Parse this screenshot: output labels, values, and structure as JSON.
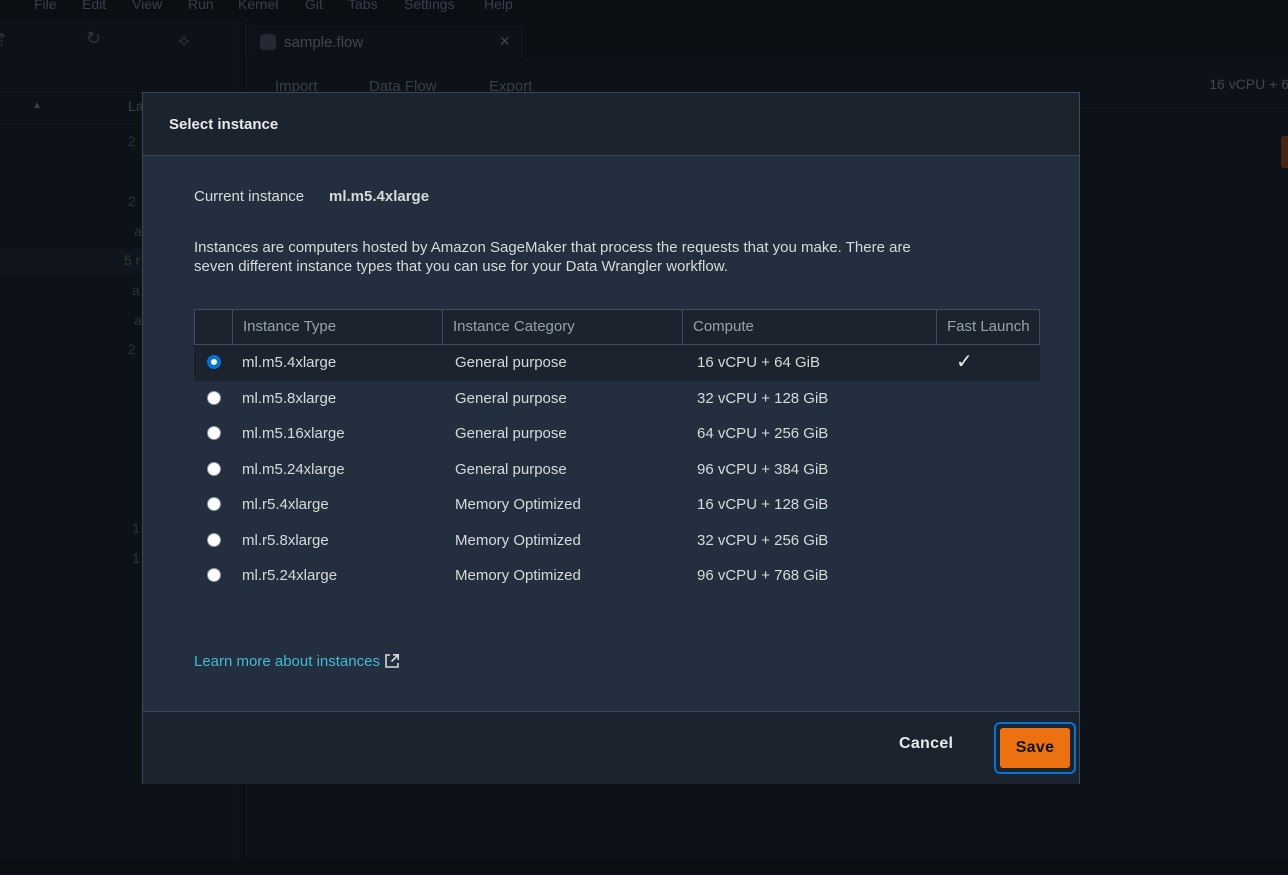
{
  "menu": [
    "File",
    "Edit",
    "View",
    "Run",
    "Kernel",
    "Git",
    "Tabs",
    "Settings",
    "Help"
  ],
  "file_tab": {
    "label": "sample.flow"
  },
  "subtabs": [
    "Import",
    "Data Flow",
    "Export"
  ],
  "top_right_label": "16 vCPU + 6",
  "left_panel": {
    "header": "La",
    "rows": [
      "2",
      "2",
      "a",
      "5 r",
      "a",
      "a",
      "2",
      "1",
      "1"
    ]
  },
  "modal": {
    "title": "Select instance",
    "current_label": "Current instance",
    "current_value": "ml.m5.4xlarge",
    "description": "Instances are computers hosted by Amazon SageMaker that process the requests that you make. There are seven different instance types that you can use for your Data Wrangler workflow.",
    "columns": [
      "Instance Type",
      "Instance Category",
      "Compute",
      "Fast Launch"
    ],
    "rows": [
      {
        "type": "ml.m5.4xlarge",
        "category": "General purpose",
        "compute": "16 vCPU + 64 GiB",
        "fast_launch": "✓",
        "selected": true
      },
      {
        "type": "ml.m5.8xlarge",
        "category": "General purpose",
        "compute": "32 vCPU + 128 GiB",
        "fast_launch": "",
        "selected": false
      },
      {
        "type": "ml.m5.16xlarge",
        "category": "General purpose",
        "compute": "64 vCPU + 256 GiB",
        "fast_launch": "",
        "selected": false
      },
      {
        "type": "ml.m5.24xlarge",
        "category": "General purpose",
        "compute": "96 vCPU + 384 GiB",
        "fast_launch": "",
        "selected": false
      },
      {
        "type": "ml.r5.4xlarge",
        "category": "Memory Optimized",
        "compute": "16 vCPU + 128 GiB",
        "fast_launch": "",
        "selected": false
      },
      {
        "type": "ml.r5.8xlarge",
        "category": "Memory Optimized",
        "compute": "32 vCPU + 256 GiB",
        "fast_launch": "",
        "selected": false
      },
      {
        "type": "ml.r5.24xlarge",
        "category": "Memory Optimized",
        "compute": "96 vCPU + 768 GiB",
        "fast_launch": "",
        "selected": false
      }
    ],
    "learn_more": "Learn more about instances",
    "learn_more_icon": "external-link-icon",
    "cancel_label": "Cancel",
    "save_label": "Save"
  },
  "colors": {
    "accent": "#ec7211",
    "link": "#44b9d6",
    "radio_selected": "#0972d3",
    "modal_bg": "#232f3e"
  }
}
